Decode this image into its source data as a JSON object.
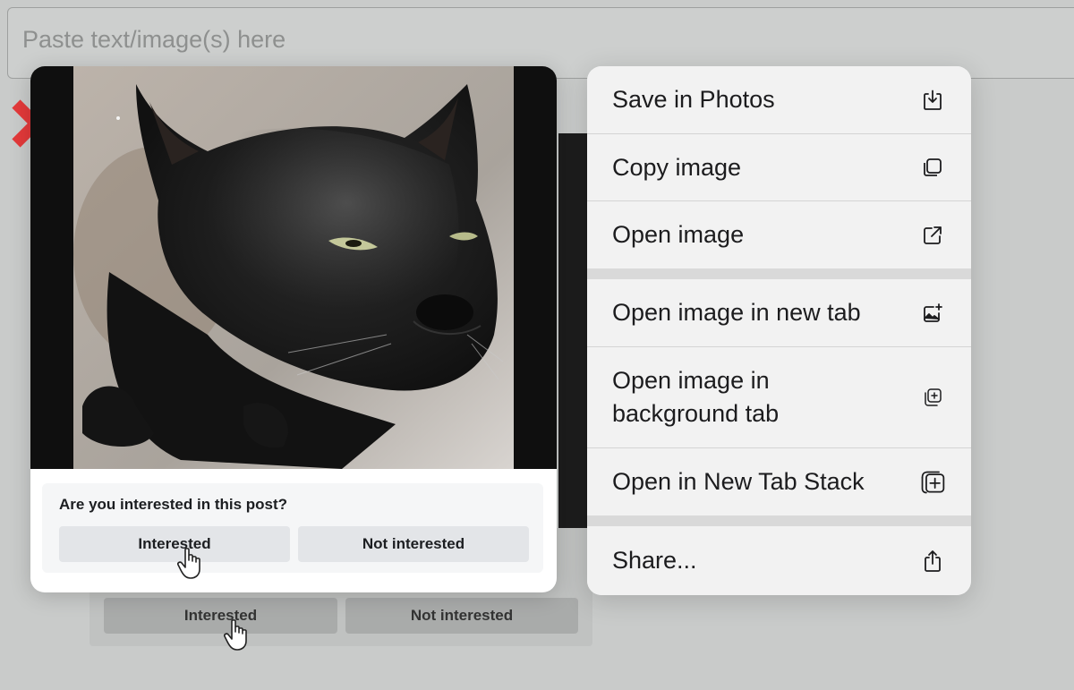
{
  "page": {
    "paste_placeholder": "Paste text/image(s) here"
  },
  "preview": {
    "poll": {
      "question": "Are you interested in this post?",
      "interested_label": "Interested",
      "not_interested_label": "Not interested"
    }
  },
  "background_poll": {
    "interested_label": "Interested",
    "not_interested_label": "Not interested"
  },
  "context_menu": {
    "items": [
      {
        "label": "Save in Photos",
        "icon": "save-to-photos-icon"
      },
      {
        "label": "Copy image",
        "icon": "copy-icon"
      },
      {
        "label": "Open image",
        "icon": "external-link-icon"
      },
      {
        "label": "Open image in new tab",
        "icon": "image-add-icon"
      },
      {
        "label": "Open image in background tab",
        "icon": "add-tab-icon"
      },
      {
        "label": "Open in New Tab Stack",
        "icon": "tab-stack-icon"
      },
      {
        "label": "Share...",
        "icon": "share-icon"
      }
    ]
  },
  "colors": {
    "backdrop": "#c9cbca",
    "menu_background": "#efefef",
    "poll_button": "#e3e5e8"
  }
}
